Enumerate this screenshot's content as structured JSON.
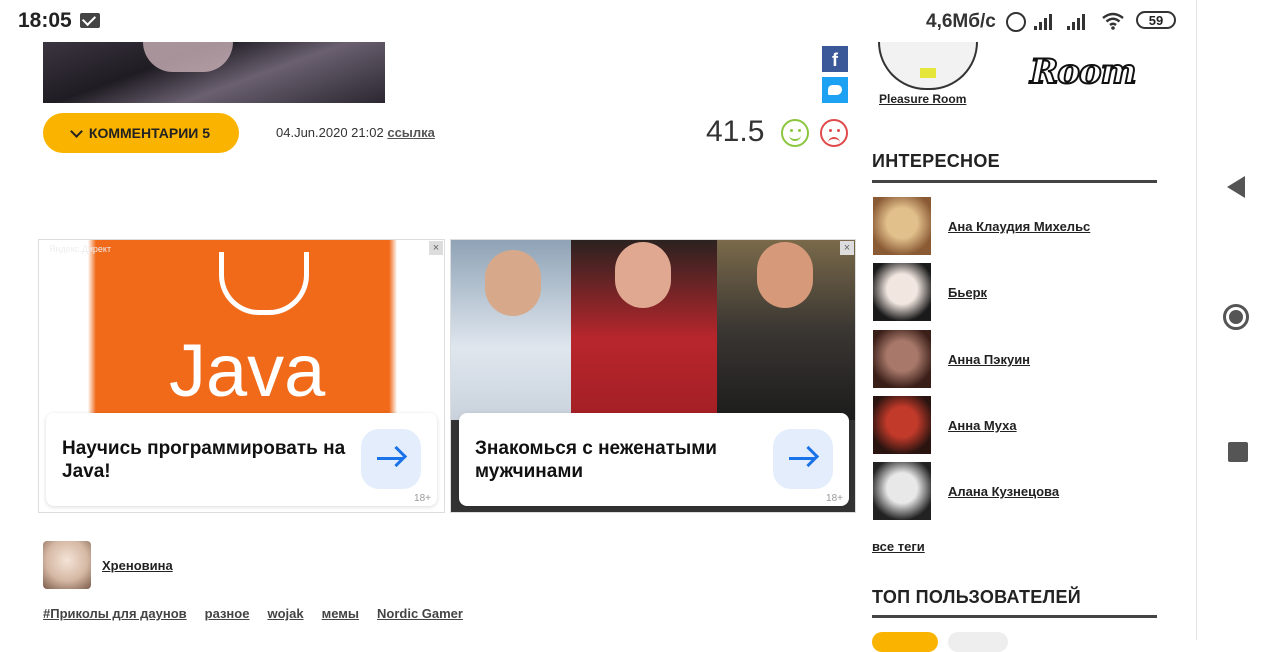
{
  "status_bar": {
    "time": "18:05",
    "speed": "4,6Мб/с",
    "battery": "59"
  },
  "post": {
    "comments_label": "КОММЕНТАРИИ 5",
    "date": "04.Jun.2020 21:02",
    "link_label": "ссылка",
    "rating": "41.5",
    "share_fb_glyph": "f"
  },
  "ads": [
    {
      "label": "Яндекс.Директ",
      "image_text": "Java",
      "title": "Научись программировать на Java!",
      "age": "18+",
      "close": "×"
    },
    {
      "title": "Знакомься с неженатыми мужчинами",
      "age": "18+",
      "close": "×"
    }
  ],
  "author": {
    "name": "Хреновина"
  },
  "tags": [
    "#Приколы для даунов",
    "разное",
    "wojak",
    "мемы",
    "Nordic Gamer"
  ],
  "sidebar": {
    "partner_label": "Pleasure Room",
    "room_logo_text": "Room",
    "interesting_heading": "ИНТЕРЕСНОЕ",
    "interesting": [
      {
        "name": "Ана Клаудия Михельс",
        "colors": [
          "#e2c08c",
          "#8a5a34"
        ]
      },
      {
        "name": "Бьерк",
        "colors": [
          "#f1e6e0",
          "#1a1a1a"
        ]
      },
      {
        "name": "Анна Пэкуин",
        "colors": [
          "#a8796a",
          "#3a1e18"
        ]
      },
      {
        "name": "Анна Муха",
        "colors": [
          "#c23a2a",
          "#2a1410"
        ]
      },
      {
        "name": "Алана Кузнецова",
        "colors": [
          "#e8e8e8",
          "#222222"
        ]
      }
    ],
    "all_tags_label": "все теги",
    "top_users_heading": "ТОП ПОЛЬЗОВАТЕЛЕЙ"
  },
  "colors": {
    "accent": "#fab400",
    "like": "#8cc63f",
    "dislike": "#e04a4a",
    "ad_link": "#1a73e8"
  }
}
